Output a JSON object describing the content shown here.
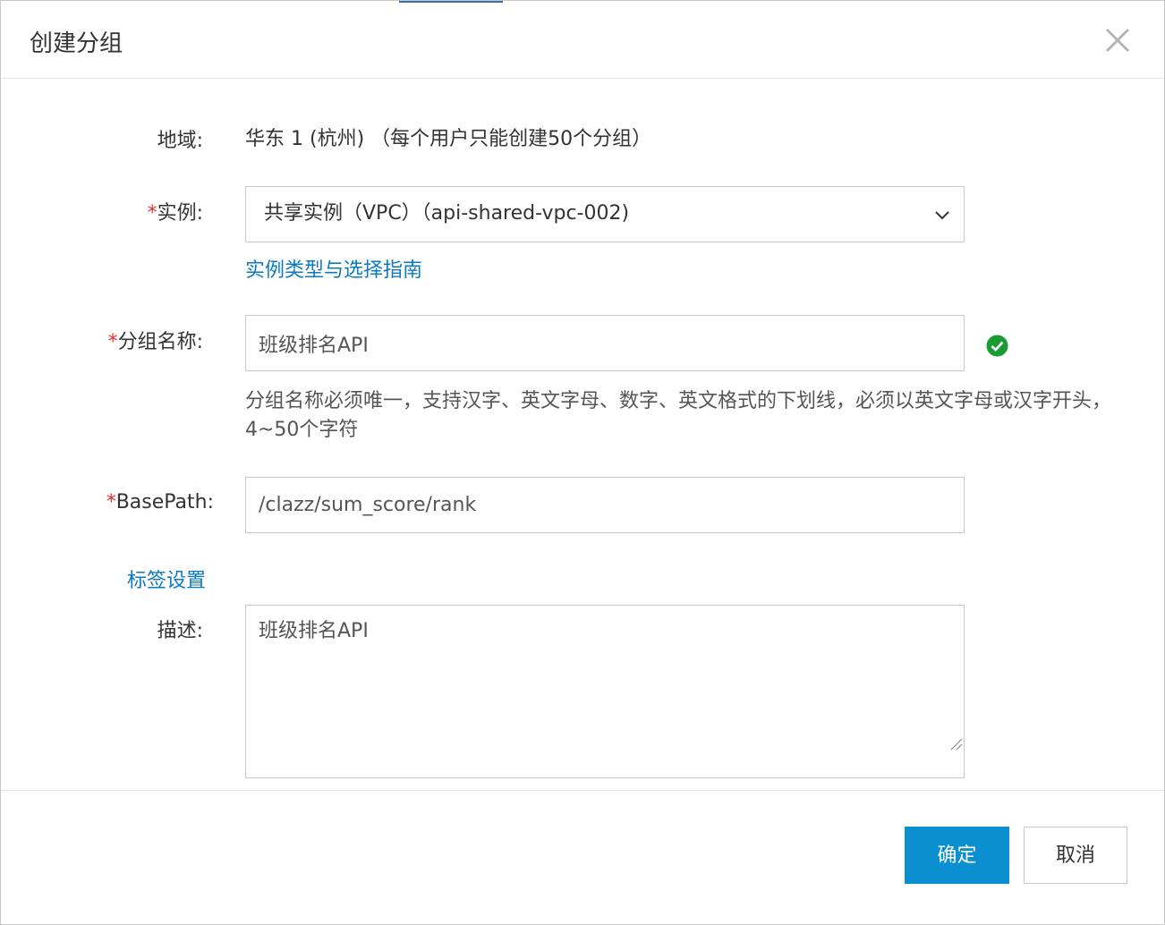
{
  "dialog": {
    "title": "创建分组"
  },
  "form": {
    "region": {
      "label": "地域:",
      "value": "华东 1 (杭州) （每个用户只能创建50个分组）"
    },
    "instance": {
      "required_mark": "*",
      "label": "实例:",
      "selected": "共享实例（VPC）（api-shared-vpc-002)",
      "guide_link": "实例类型与选择指南"
    },
    "group_name": {
      "required_mark": "*",
      "label": "分组名称:",
      "value": "班级排名API",
      "validation": "valid",
      "help": "分组名称必须唯一，支持汉字、英文字母、数字、英文格式的下划线，必须以英文字母或汉字开头，4~50个字符"
    },
    "base_path": {
      "required_mark": "*",
      "label": "BasePath:",
      "value": "/clazz/sum_score/rank"
    },
    "tag_link": "标签设置",
    "description": {
      "label": "描述:",
      "value": "班级排名API"
    }
  },
  "footer": {
    "confirm_label": "确定",
    "cancel_label": "取消"
  },
  "colors": {
    "primary": "#0b8fd0",
    "link": "#0b79c6",
    "required": "#e0322b",
    "success": "#1a9b34"
  },
  "icons": {
    "close": "close-icon",
    "select_arrow": "chevron-down-icon",
    "valid": "check-circle-icon",
    "resize": "resize-grip-icon"
  }
}
